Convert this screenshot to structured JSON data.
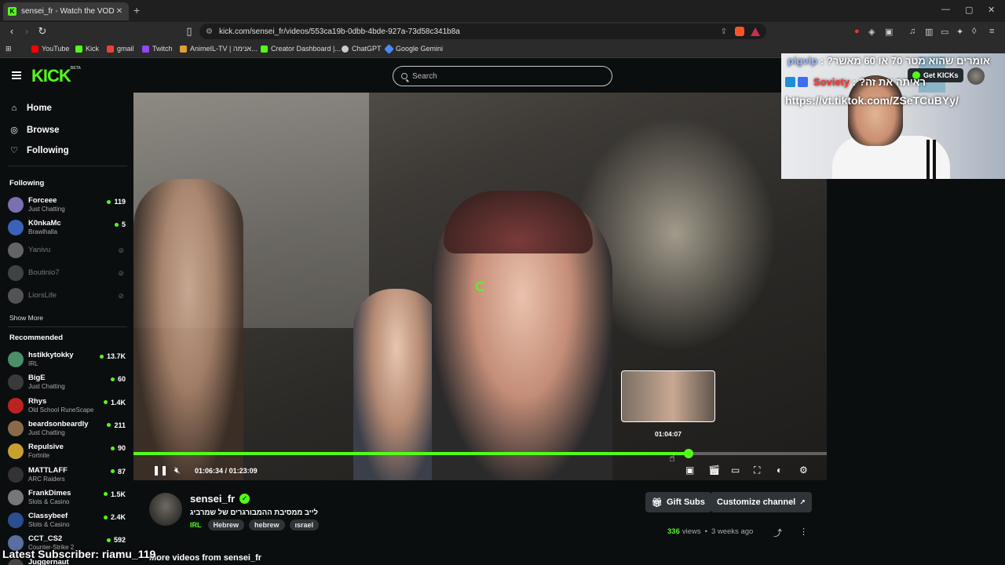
{
  "browser": {
    "tab_title": "sensei_fr - Watch the VOD on Ki",
    "tab_close": "✕",
    "new_tab": "+",
    "minimize": "—",
    "maximize": "▢",
    "close": "✕",
    "url": "kick.com/sensei_fr/videos/553ca19b-0dbb-4bde-927a-73d58c341b8a",
    "bookmarks": [
      {
        "label": "YouTube",
        "color": "#ff0000"
      },
      {
        "label": "Kick",
        "color": "#53fc18"
      },
      {
        "label": "gmail",
        "color": "#ea4335"
      },
      {
        "label": "Twitch",
        "color": "#9146ff"
      },
      {
        "label": "AnimeIL-TV | אנימה...",
        "color": "#e0a030"
      },
      {
        "label": "Creator Dashboard |...",
        "color": "#53fc18"
      },
      {
        "label": "ChatGPT",
        "color": "#cccccc"
      },
      {
        "label": "Google Gemini",
        "color": "#4c8bf5"
      }
    ]
  },
  "kick": {
    "logo": "KICK",
    "logo_beta": "BETA",
    "search_placeholder": "Search",
    "nav": [
      {
        "label": "Home",
        "icon": "home-icon"
      },
      {
        "label": "Browse",
        "icon": "compass-icon"
      },
      {
        "label": "Following",
        "icon": "heart-icon"
      }
    ],
    "following_heading": "Following",
    "following": [
      {
        "name": "Forceee",
        "category": "Just Chatting",
        "viewers": "119",
        "live": true
      },
      {
        "name": "K0nkaMc",
        "category": "Brawlhalla",
        "viewers": "5",
        "live": true
      },
      {
        "name": "Yanivu",
        "live": false
      },
      {
        "name": "Boutinio7",
        "live": false
      },
      {
        "name": "LiorsLife",
        "live": false
      }
    ],
    "show_more": "Show More",
    "recommended_heading": "Recommended",
    "recommended": [
      {
        "name": "hstikkytokky",
        "category": "IRL",
        "viewers": "13.7K"
      },
      {
        "name": "BigE",
        "category": "Just Chatting",
        "viewers": "60"
      },
      {
        "name": "Rhys",
        "category": "Old School RuneScape",
        "viewers": "1.4K"
      },
      {
        "name": "beardsonbeardly",
        "category": "Just Chatting",
        "viewers": "211"
      },
      {
        "name": "Repulsive",
        "category": "Fortnite",
        "viewers": "90"
      },
      {
        "name": "MATTLAFF",
        "category": "ARC Raiders",
        "viewers": "87"
      },
      {
        "name": "FrankDimes",
        "category": "Slots & Casino",
        "viewers": "1.5K"
      },
      {
        "name": "Classybeef",
        "category": "Slots & Casino",
        "viewers": "2.4K"
      },
      {
        "name": "CCT_CS2",
        "category": "Counter-Strike 2",
        "viewers": "592"
      },
      {
        "name": "Juggernaut",
        "category": "",
        "viewers": ""
      }
    ],
    "get_kicks": "Get KICKs"
  },
  "player": {
    "current_time": "01:06:34",
    "duration": "01:23:09",
    "time_separator": "/",
    "progress_fraction": 0.8006,
    "hover_time": "01:04:07"
  },
  "channel": {
    "name": "sensei_fr",
    "verified_mark": "✓",
    "video_title": "לייב ממסיבת ההמבורגרים של שמרביג",
    "category": "IRL",
    "tags": [
      "Hebrew",
      "hebrew",
      "ısrael"
    ],
    "gift_subs": "Gift Subs",
    "customize": "Customize channel",
    "views": "336",
    "views_label": "views",
    "posted": "3 weeks ago",
    "more_videos": "More videos from sensei_fr"
  },
  "overlay": {
    "chat1_user": "pigvip",
    "chat1_text": "אומרים שהוא מטר 70 או 60 מאשר?",
    "chat2_user": "Soviety",
    "chat2_text": "ראיתה את זה?",
    "chat3_text": "https://vt.tiktok.com/ZSeTCuBYy/",
    "latest_sub": "Latest Subscriber: riamu_119"
  }
}
